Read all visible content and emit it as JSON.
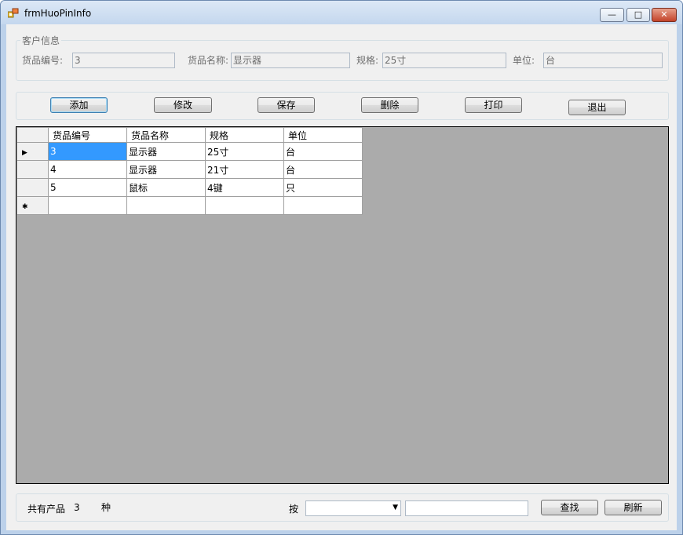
{
  "window": {
    "title": "frmHuoPinInfo",
    "min_glyph": "—",
    "max_glyph": "□",
    "close_glyph": "✕"
  },
  "customer_group": {
    "title": "客户信息",
    "fields": [
      {
        "label": "货品编号:",
        "value": "3"
      },
      {
        "label": "货品名称:",
        "value": "显示器"
      },
      {
        "label": "规格:",
        "value": "25寸"
      },
      {
        "label": "单位:",
        "value": "台"
      }
    ]
  },
  "toolbar": {
    "add": "添加",
    "edit": "修改",
    "save": "保存",
    "delete": "删除",
    "print": "打印",
    "exit": "退出"
  },
  "grid": {
    "columns": [
      "货品编号",
      "货品名称",
      "规格",
      "单位"
    ],
    "rows": [
      [
        "3",
        "显示器",
        "25寸",
        "台"
      ],
      [
        "4",
        "显示器",
        "21寸",
        "台"
      ],
      [
        "5",
        "鼠标",
        "4键",
        "只"
      ]
    ],
    "current_row_glyph": "▶",
    "new_row_glyph": "✱"
  },
  "footer": {
    "total_label": "共有产品",
    "total_count": "3",
    "unit": "种",
    "search_by_label": "按",
    "search_field_value": "",
    "search_text": "",
    "find": "查找",
    "refresh": "刷新"
  },
  "colors": {
    "selection": "#3399ff",
    "grid_background": "#ababab",
    "window_frame": "#bcd1ea"
  }
}
